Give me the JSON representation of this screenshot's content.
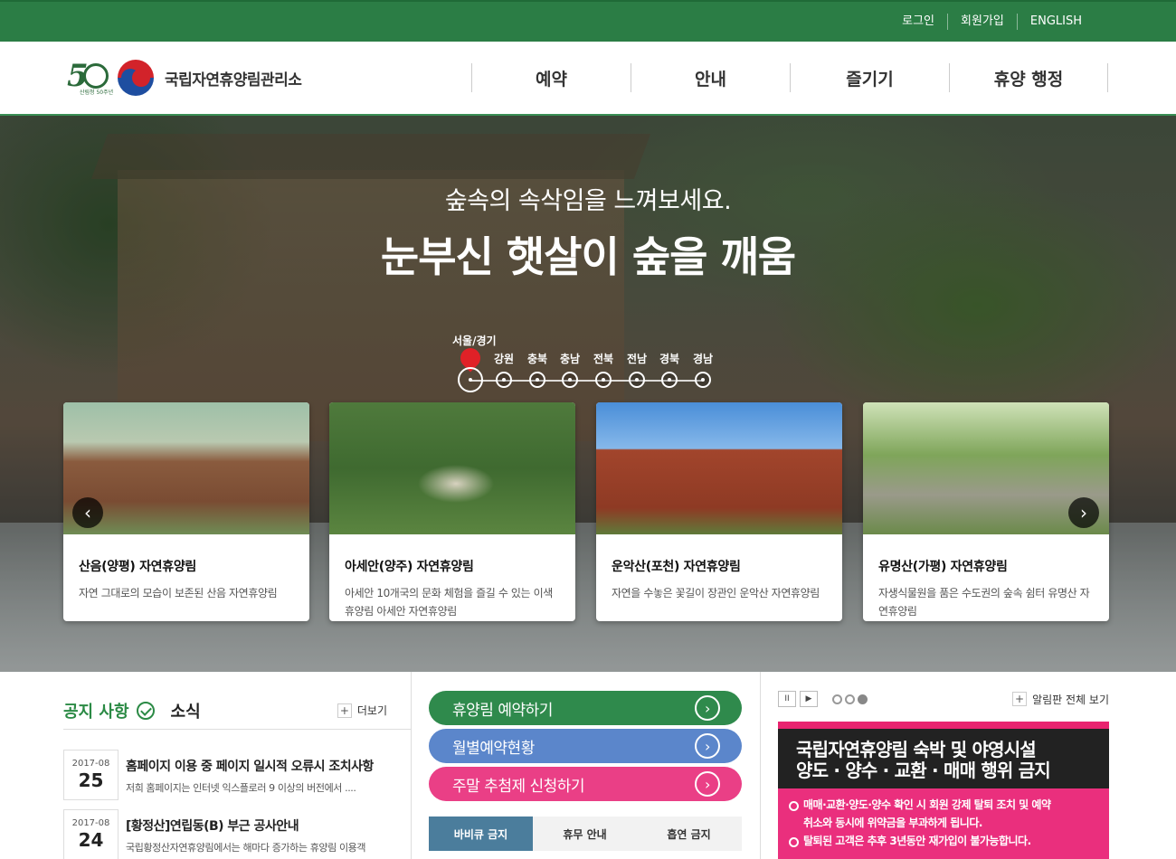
{
  "topbar": {
    "links": [
      "로그인",
      "회원가입",
      "ENGLISH"
    ]
  },
  "header": {
    "logo_50_sub": "산림청 50주년",
    "org_name": "국립자연휴양림관리소",
    "nav": [
      "예약",
      "안내",
      "즐기기",
      "휴양 행정"
    ]
  },
  "hero": {
    "subtitle": "숲속의 속삭임을 느껴보세요.",
    "title": "눈부신 햇살이 숲을 깨움",
    "regions": [
      "서울/경기",
      "강원",
      "충북",
      "충남",
      "전북",
      "전남",
      "경북",
      "경남"
    ],
    "active_region": "서울/경기",
    "prev_label": "‹",
    "next_label": "›",
    "cards": [
      {
        "title": "산음(양평) 자연휴양림",
        "desc": "자연 그대로의 모습이 보존된 산음 자연휴양림"
      },
      {
        "title": "아세안(양주) 자연휴양림",
        "desc": "아세안 10개국의 문화 체험을 즐길 수 있는 이색 휴양림 아세안 자연휴양림"
      },
      {
        "title": "운악산(포천) 자연휴양림",
        "desc": "자연을 수놓은 꽃길이 장관인 운악산 자연휴양림"
      },
      {
        "title": "유명산(가평) 자연휴양림",
        "desc": "자생식물원을 품은 수도권의 숲속 쉼터 유명산 자연휴양림"
      }
    ]
  },
  "notice": {
    "tab_notice": "공지 사항",
    "tab_news": "소식",
    "more": "더보기",
    "posts": [
      {
        "ym": "2017-08",
        "day": "25",
        "title": "홈페이지 이용 중 페이지 일시적 오류시 조치사항",
        "desc": "저희 홈페이지는 인터넷 익스플로러 9 이상의 버전에서 ...."
      },
      {
        "ym": "2017-08",
        "day": "24",
        "title": "[황정산]연립동(B) 부근 공사안내",
        "desc": "국립황정산자연휴양림에서는 해마다 증가하는 휴양림 이용객"
      }
    ]
  },
  "quick": {
    "buttons": [
      {
        "label": "휴양림 예약하기",
        "color": "#2f8a4c"
      },
      {
        "label": "월별예약현황",
        "color": "#5b86cb"
      },
      {
        "label": "주말 추첨제 신청하기",
        "color": "#ea3f86"
      }
    ],
    "go_icon": "›",
    "tabs": [
      "바비큐 금지",
      "휴무 안내",
      "흡연 금지"
    ],
    "active_tab": "바비큐 금지"
  },
  "board": {
    "pause": "II",
    "play": "▶",
    "view_all": "알림판 전체 보기",
    "pages": 3,
    "active_page": 3,
    "banner_title_1": "국립자연휴양림 숙박 및 야영시설",
    "banner_title_2": "양도 · 양수 · 교환 · 매매 행위 금지",
    "banner_line_1a": "매매·교환·양도·양수 확인 시 회원 강제 탈퇴 조치 및 예약",
    "banner_line_1b": "취소와 동시에 위약금을 부과하게 됩니다.",
    "banner_line_2": "탈퇴된 고객은 추후 3년동안 재가입이 불가능합니다."
  },
  "plus_sign": "+",
  "colors": {
    "topbar": "#2b7d45",
    "accent_green": "#2b8a45",
    "banner_pink": "#ea2f7d",
    "region_pin": "#e02127"
  }
}
